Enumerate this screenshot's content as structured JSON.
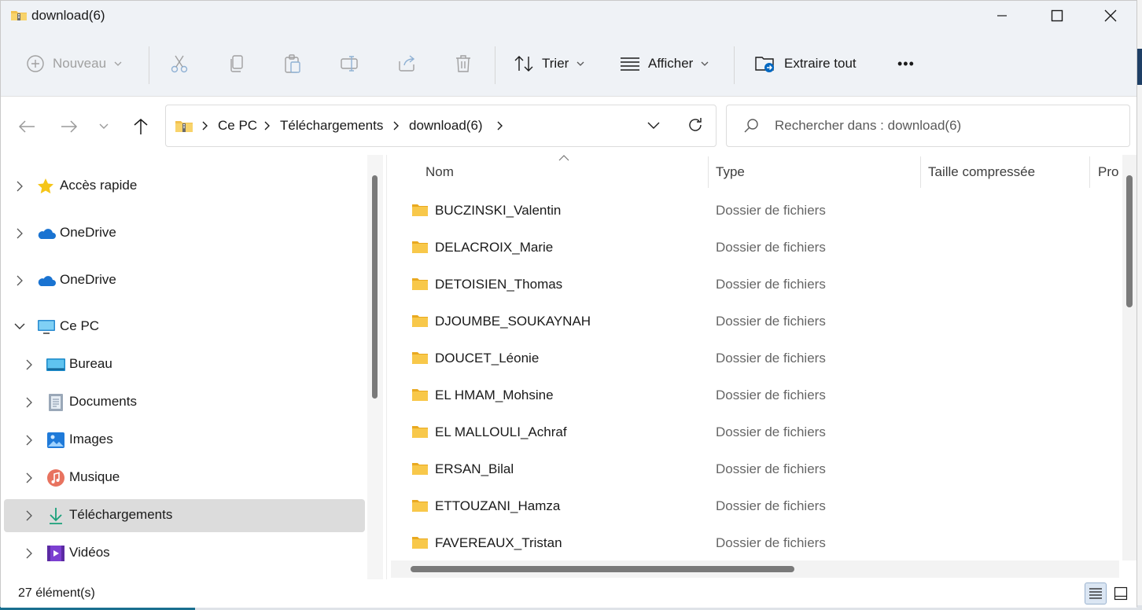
{
  "window": {
    "title": "download(6)"
  },
  "toolbar": {
    "new_label": "Nouveau",
    "sort_label": "Trier",
    "view_label": "Afficher",
    "extract_label": "Extraire tout",
    "more_label": "•••"
  },
  "address": {
    "crumbs": [
      "Ce PC",
      "Téléchargements",
      "download(6)"
    ],
    "search_placeholder": "Rechercher dans : download(6)"
  },
  "navpane": {
    "items": [
      {
        "label": "Accès rapide",
        "icon": "star-icon"
      },
      {
        "label": "OneDrive",
        "icon": "cloud-icon"
      },
      {
        "label": "OneDrive",
        "icon": "cloud-icon"
      },
      {
        "label": "Ce PC",
        "icon": "computer-icon"
      },
      {
        "label": "Bureau",
        "icon": "desktop-icon"
      },
      {
        "label": "Documents",
        "icon": "documents-icon"
      },
      {
        "label": "Images",
        "icon": "pictures-icon"
      },
      {
        "label": "Musique",
        "icon": "music-icon"
      },
      {
        "label": "Téléchargements",
        "icon": "download-icon"
      },
      {
        "label": "Vidéos",
        "icon": "videos-icon"
      }
    ]
  },
  "list": {
    "columns": [
      "Nom",
      "Type",
      "Taille compressée",
      "Pro"
    ],
    "rows": [
      {
        "name": "BUCZINSKI_Valentin",
        "type": "Dossier de fichiers"
      },
      {
        "name": "DELACROIX_Marie",
        "type": "Dossier de fichiers"
      },
      {
        "name": "DETOISIEN_Thomas",
        "type": "Dossier de fichiers"
      },
      {
        "name": "DJOUMBE_SOUKAYNAH",
        "type": "Dossier de fichiers"
      },
      {
        "name": "DOUCET_Léonie",
        "type": "Dossier de fichiers"
      },
      {
        "name": "EL HMAM_Mohsine",
        "type": "Dossier de fichiers"
      },
      {
        "name": "EL MALLOULI_Achraf",
        "type": "Dossier de fichiers"
      },
      {
        "name": "ERSAN_Bilal",
        "type": "Dossier de fichiers"
      },
      {
        "name": "ETTOUZANI_Hamza",
        "type": "Dossier de fichiers"
      },
      {
        "name": "FAVEREAUX_Tristan",
        "type": "Dossier de fichiers"
      }
    ]
  },
  "status": {
    "count": "27 élément(s)"
  },
  "colors": {
    "accent": "#0067c0",
    "folder": "#f8c84a",
    "selection": "#dcdcdc"
  }
}
